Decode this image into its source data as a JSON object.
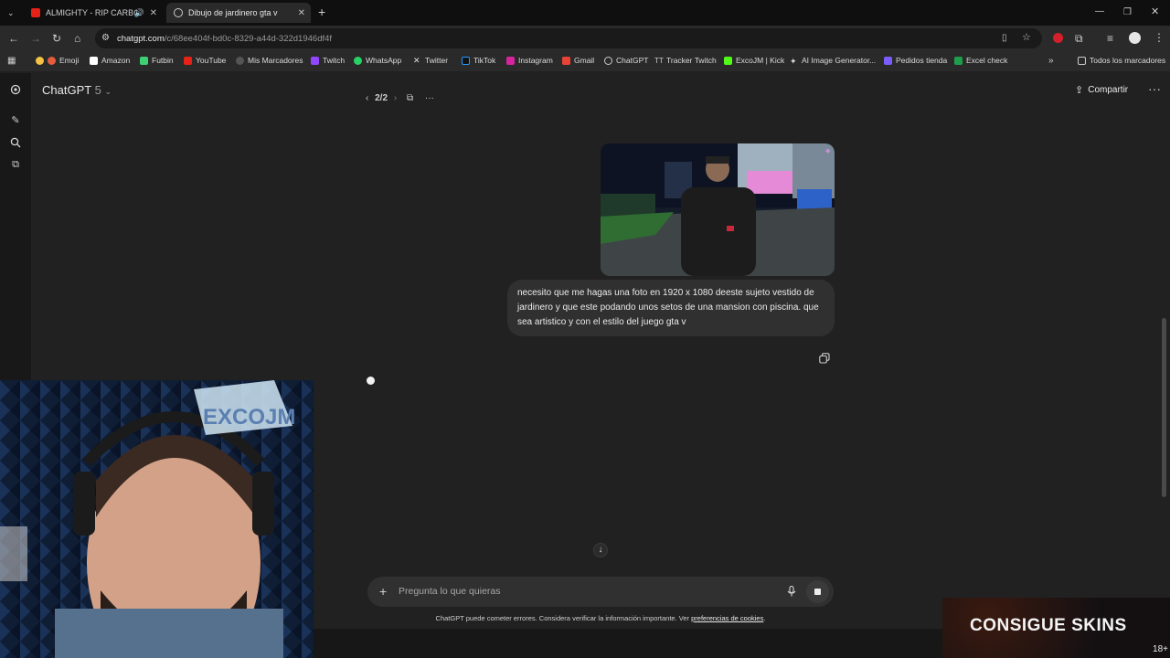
{
  "browser": {
    "tabs": [
      {
        "label": "ALMIGHTY - RIP CARBON (",
        "active": false
      },
      {
        "label": "Dibujo de jardinero gta v",
        "active": true
      }
    ],
    "url_host": "chatgpt.com",
    "url_path": "/c/68ee404f-bd0c-8329-a44d-322d1946df4f",
    "bookmarks": [
      "Emoji",
      "Amazon",
      "Futbin",
      "YouTube",
      "Mis Marcadores",
      "Twitch",
      "WhatsApp",
      "Twitter",
      "TikTok",
      "Instagram",
      "Gmail",
      "ChatGPT",
      "Tracker Twitch",
      "ExcoJM | Kick",
      "AI Image Generator...",
      "Pedidos tienda",
      "Excel check"
    ],
    "all_bookmarks": "Todos los marcadores"
  },
  "app": {
    "model_name": "ChatGPT",
    "model_version": "5",
    "pager": "2/2",
    "share_label": "Compartir",
    "message_text": "necesito que me hagas una foto en 1920 x 1080 deeste sujeto vestido de jardinero y que este podando unos setos de una mansion con piscina. que sea artistico y con el estilo del juego gta v",
    "composer_placeholder": "Pregunta lo que quieras",
    "footer_text": "ChatGPT puede cometer errores. Considera verificar la información importante. Ver ",
    "footer_link": "preferencias de cookies",
    "footer_end": "."
  },
  "overlay": {
    "webcam_logo": "EXCOJM",
    "promo_text": "CONSIGUE SKINS",
    "promo_age": "18+"
  },
  "colors": {
    "page_bg": "#212121",
    "bubble_bg": "#303030",
    "tab_bar": "#0f0f0f",
    "toolbar": "#2a2a2a"
  }
}
